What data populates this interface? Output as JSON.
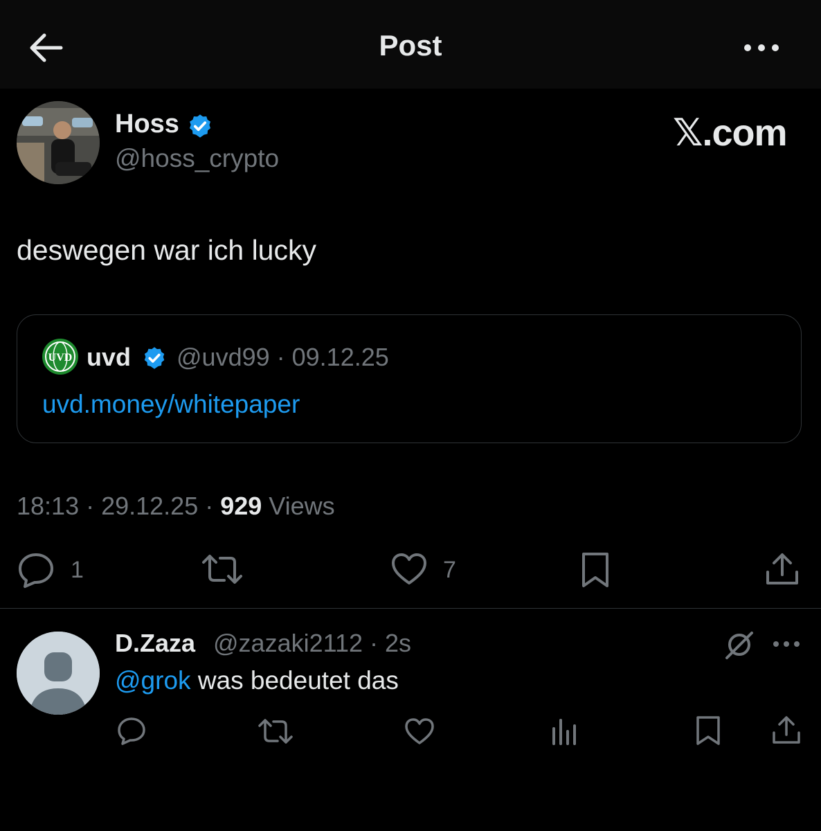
{
  "header": {
    "title": "Post",
    "back_icon": "arrow-left-icon",
    "more_icon": "more-horizontal-icon"
  },
  "post": {
    "author_name": "Hoss",
    "author_handle": "@hoss_crypto",
    "watermark": "𝕏.com",
    "text": "deswegen war ich lucky",
    "quote": {
      "avatar_text": "UVD",
      "name": "uvd",
      "meta": "@uvd99 · 09.12.25",
      "link": "uvd.money/whitepaper"
    },
    "time": "18:13 · 29.12.25 · ",
    "views_count": "929",
    "views_label": " Views",
    "actions": {
      "reply_count": "1",
      "like_count": "7"
    }
  },
  "reply": {
    "name": "D.Zaza",
    "meta": "@zazaki2112 · 2s",
    "mention": "@grok",
    "text": " was bedeutet das"
  },
  "colors": {
    "accent": "#1d9bf0",
    "muted": "#71767b",
    "text": "#e7e9ea",
    "background": "#000000"
  }
}
